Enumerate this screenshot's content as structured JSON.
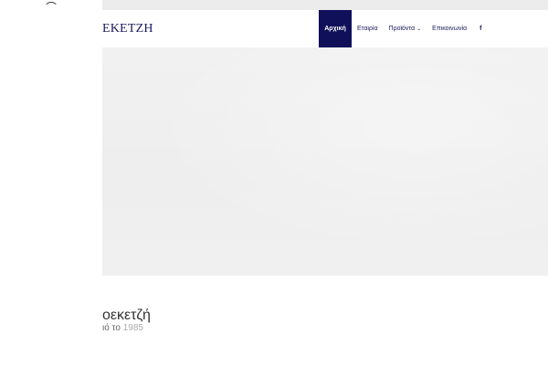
{
  "header": {
    "logo_text": "ΕΚΕΤΖΗ"
  },
  "nav": {
    "items": [
      {
        "label": "Αρχική",
        "active": true
      },
      {
        "label": "Εταιρία",
        "active": false
      },
      {
        "label": "Προϊόντα",
        "active": false,
        "chevron": "⌄"
      },
      {
        "label": "Επικοινωνία",
        "active": false
      }
    ],
    "facebook_label": "f"
  },
  "hero": {
    "title": "οεκετζή",
    "subtitle_prefix": "ιό το",
    "subtitle_year": "1985"
  },
  "colors": {
    "brand": "#10105a",
    "hero_bg": "#efefef"
  }
}
